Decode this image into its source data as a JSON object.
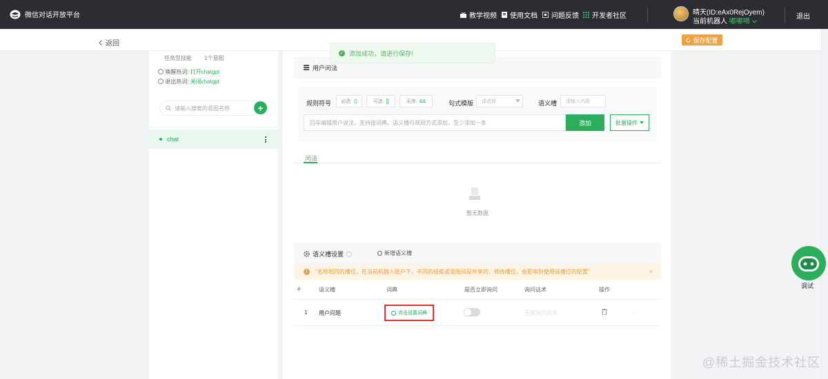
{
  "topbar": {
    "brand": "微信对话开放平台",
    "nav": [
      {
        "label": "教学视频",
        "icon": "video-icon"
      },
      {
        "label": "使用文档",
        "icon": "doc-icon"
      },
      {
        "label": "问题反馈",
        "icon": "feedback-icon"
      },
      {
        "label": "开发者社区",
        "icon": "grid-icon"
      }
    ],
    "user_name": "晴天(ID:eAx0RejOyem)",
    "bot_prefix": "当前机器人",
    "bot_name": "嘟嘟嘀",
    "logout": "退出"
  },
  "subbar": {
    "back": "返回",
    "save": "保存配置"
  },
  "toast": {
    "text": "添加成功，请进行保存!"
  },
  "left": {
    "tags": [
      "任务型技能",
      "1个意图"
    ],
    "hot_enter_label": "唤醒热词:",
    "hot_enter_value": "打开chatgpt",
    "hot_exit_label": "退出热词:",
    "hot_exit_value": "关闭chatgpt",
    "search_placeholder": "请输入搜索的意图名称",
    "intents": [
      {
        "name": "chat"
      }
    ]
  },
  "main": {
    "user_query_title": "用户问法",
    "rule_symbol_label": "规则符号",
    "chips": [
      {
        "label": "必选:",
        "value": "()"
      },
      {
        "label": "可选:",
        "value": "[]"
      },
      {
        "label": "无序:",
        "value": "&&"
      }
    ],
    "template_label": "句式模版",
    "template_placeholder": "请选择",
    "slot_label": "语义槽",
    "slot_placeholder": "请输入内容",
    "query_placeholder": "回车编辑用户说法，支持按词典、语义槽与规则方式添加，至少添加一条",
    "add_button": "添加",
    "batch_button": "批量操作",
    "tab_label": "问法",
    "empty_text": "暂无数据",
    "slot_section_title": "语义槽设置",
    "new_slot": "新增语义槽",
    "warning": "\"名称相同的槽位，在当前机器人账户下，不同的技能或意图间是共享的，修改槽位，会影响到使用该槽位的配置\"",
    "table_headers": [
      "#",
      "语义槽",
      "词典",
      "是否立即询问",
      "询问话术",
      "操作"
    ],
    "rows": [
      {
        "index": "1",
        "slot": "用户问题",
        "dict": "点击设置词典",
        "ask": false,
        "ask_text": "无需询问话术"
      }
    ]
  },
  "float": {
    "label": "调试"
  },
  "watermark": "@稀土掘金技术社区",
  "colors": {
    "brand_green": "#2aae5c",
    "topbar": "#2b2d33",
    "save_orange": "#e9a345",
    "warning": "#e8a03c",
    "highlight_red": "#e03030"
  }
}
